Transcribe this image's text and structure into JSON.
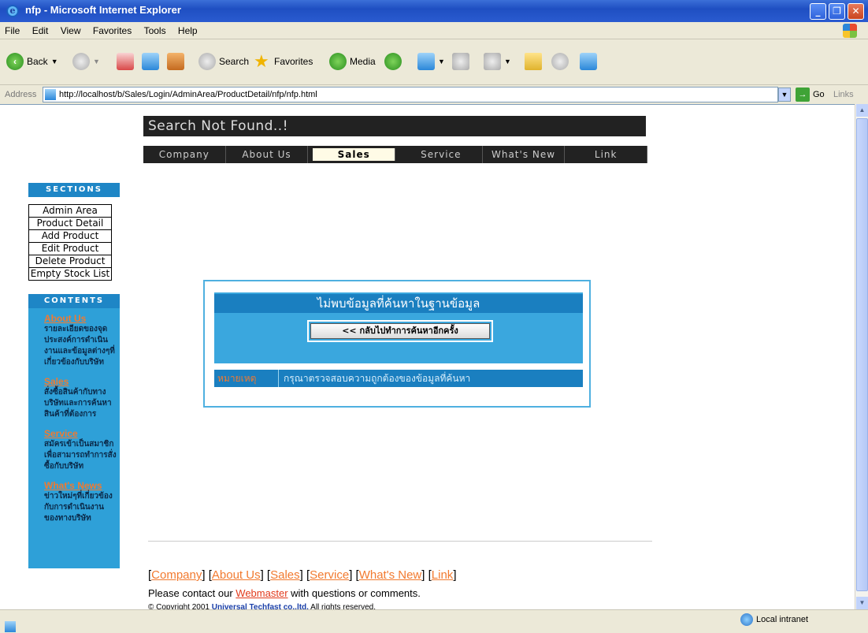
{
  "window": {
    "title": "nfp - Microsoft Internet Explorer"
  },
  "menu": {
    "items": [
      "File",
      "Edit",
      "View",
      "Favorites",
      "Tools",
      "Help"
    ]
  },
  "toolbar": {
    "back_label": "Back",
    "search_label": "Search",
    "favorites_label": "Favorites",
    "media_label": "Media"
  },
  "address": {
    "label": "Address",
    "url": "http://localhost/b/Sales/Login/AdminArea/ProductDetail/nfp/nfp.html",
    "go_label": "Go",
    "links_label": "Links"
  },
  "page": {
    "banner": "Search Not Found..!",
    "nav": [
      "Company",
      "About Us",
      "Sales",
      "Service",
      "What's New",
      "Link"
    ],
    "nav_active": "Sales",
    "sections_heading": "SECTIONS",
    "sections": [
      "Admin Area",
      "Product Detail",
      "Add Product",
      "Edit Product",
      "Delete Product",
      "Empty Stock List"
    ],
    "contents_heading": "CONTENTS",
    "contents": [
      {
        "title": "About Us",
        "text": "รายละเอียดของจุดประสงค์การดำเนินงานและข้อมูลต่างๆที่เกี่ยวข้องกับบริษัท"
      },
      {
        "title": "Sales",
        "text": "สั่งซื้อสินค้ากับทางบริษัทและการค้นหาสินค้าที่ต้องการ"
      },
      {
        "title": "Service",
        "text": "สมัครเข้าเป็นสมาชิกเพื่อสามารถทำการสั่งซื้อกับบริษัท"
      },
      {
        "title": "What's News",
        "text": "ข่าวใหม่ๆที่เกี่ยวข้องกับการดำเนินงานของทางบริษัท"
      }
    ],
    "notice": {
      "message": "ไม่พบข้อมูลที่ค้นหาในฐานข้อมูล",
      "back_button": "<< กลับไปทำการค้นหาอีกครั้ง",
      "note_label": "หมายเหตุ",
      "note_text": "กรุณาตรวจสอบความถูกต้องของข้อมูลที่ค้นหา"
    },
    "footer": {
      "links": [
        "Company",
        "About Us",
        "Sales",
        "Service",
        "What's New",
        "Link"
      ],
      "contact_prefix": "Please contact our ",
      "webmaster": "Webmaster",
      "contact_suffix": " with questions or comments.",
      "copyright_prefix": "© Copyright 2001 ",
      "company": "Universal Techfast co.,ltd.",
      "copyright_suffix": " All rights reserved."
    }
  },
  "status": {
    "zone": "Local intranet"
  }
}
